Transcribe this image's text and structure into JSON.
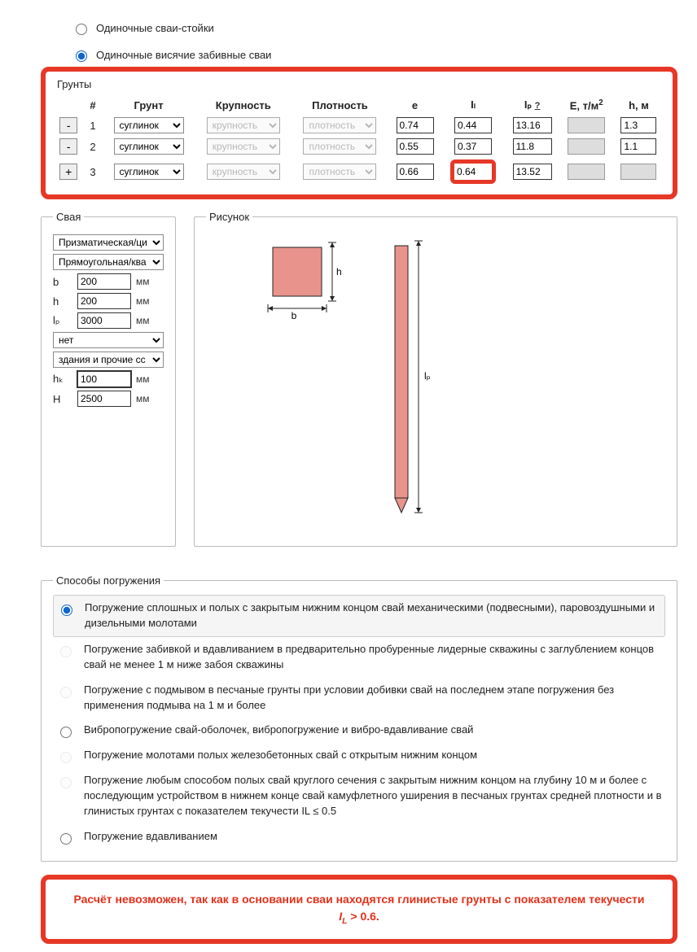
{
  "radios": {
    "single_stand_piles": "Одиночные сваи-стойки",
    "single_driven_friction_piles": "Одиночные висячие забивные сваи"
  },
  "soils": {
    "legend": "Грунты",
    "headers": {
      "num": "#",
      "soil": "Грунт",
      "coarseness": "Крупность",
      "density": "Плотность",
      "e": "e",
      "il": "Iₗ",
      "ip": "Iₚ",
      "ip_help": "?",
      "E": "E, т/м",
      "E_sup": "2",
      "h": "h, м"
    },
    "placeholders": {
      "coarseness": "крупность",
      "density": "плотность"
    },
    "rows": [
      {
        "btn": "-",
        "n": "1",
        "soil": "суглинок",
        "e": "0.74",
        "il": "0.44",
        "ip": "13.16",
        "E": "",
        "h": "1.3",
        "il_hl": false
      },
      {
        "btn": "-",
        "n": "2",
        "soil": "суглинок",
        "e": "0.55",
        "il": "0.37",
        "ip": "11.8",
        "E": "",
        "h": "1.1",
        "il_hl": false
      },
      {
        "btn": "+",
        "n": "3",
        "soil": "суглинок",
        "e": "0.66",
        "il": "0.64",
        "ip": "13.52",
        "E": "",
        "h": "",
        "il_hl": true
      }
    ]
  },
  "pile": {
    "legend": "Свая",
    "shape1": "Призматическая/ци",
    "shape2": "Прямоугольная/ква",
    "b": {
      "lbl": "b",
      "val": "200",
      "unit": "мм"
    },
    "h": {
      "lbl": "h",
      "val": "200",
      "unit": "мм"
    },
    "lp": {
      "lbl": "lₚ",
      "val": "3000",
      "unit": "мм"
    },
    "opt1": "нет",
    "opt2": "здания и прочие сс",
    "hk": {
      "lbl": "hₖ",
      "val": "100",
      "unit": "мм"
    },
    "H": {
      "lbl": "H",
      "val": "2500",
      "unit": "мм"
    }
  },
  "figure": {
    "legend": "Рисунок",
    "b": "b",
    "h": "h",
    "lp": "lₚ"
  },
  "methods": {
    "legend": "Способы погружения",
    "items": [
      {
        "text": "Погружение сплошных и полых с закрытым нижним концом свай механическими (подвесными), паровоздушными и дизельными молотами",
        "selected": true,
        "disabled": false
      },
      {
        "text": "Погружение забивкой и вдавливанием в предварительно пробуренные лидерные скважины с заглублением концов свай не менее 1 м ниже забоя скважины",
        "selected": false,
        "disabled": true
      },
      {
        "text": "Погружение с подмывом в песчаные грунты при условии добивки свай на последнем этапе погружения без применения подмыва на 1 м и более",
        "selected": false,
        "disabled": true
      },
      {
        "text": "Вибропогружение свай-оболочек, вибропогружение и вибро-вдавливание свай",
        "selected": false,
        "disabled": false
      },
      {
        "text": "Погружение молотами полых железобетонных свай с открытым нижним концом",
        "selected": false,
        "disabled": true
      },
      {
        "text": "Погружение любым способом полых свай круглого сечения с закрытым нижним концом на глубину 10 м и более с последующим устройством в нижнем конце свай камуфлетного уширения в песчаных грунтах средней плотности и в глинистых грунтах с показателем текучести IL ≤ 0.5",
        "selected": false,
        "disabled": true
      },
      {
        "text": "Погружение вдавливанием",
        "selected": false,
        "disabled": false
      }
    ]
  },
  "error": {
    "pre": "Расчёт невозможен, так как в основании сваи находятся глинистые грунты с показателем текучести ",
    "sym": "I",
    "sub": "L",
    "post": " > 0.6."
  }
}
